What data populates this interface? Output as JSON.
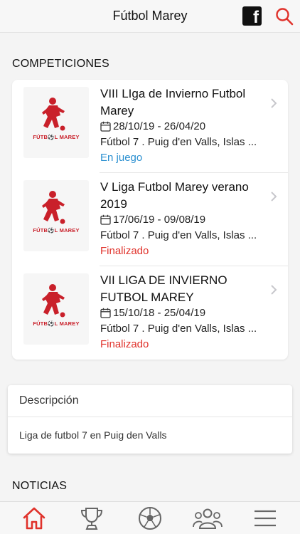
{
  "header": {
    "title": "Fútbol Marey",
    "facebook_icon": "facebook-icon",
    "search_icon": "search-icon",
    "accent_color": "#e0322b"
  },
  "competitions": {
    "section_title": "COMPETICIONES",
    "items": [
      {
        "name": "VIII LIga de Invierno Futbol Marey",
        "dates": "28/10/19 - 26/04/20",
        "place": "Fútbol 7 . Puig d'en Valls, Islas ...",
        "status": "En juego",
        "logo_text": "FÚTB⚽L MAREY"
      },
      {
        "name": "V Liga Futbol Marey verano 2019",
        "dates": "17/06/19 - 09/08/19",
        "place": "Fútbol 7 . Puig d'en Valls, Islas ...",
        "status": "Finalizado",
        "logo_text": "FÚTB⚽L MAREY"
      },
      {
        "name": "VII LIGA DE INVIERNO FUTBOL MAREY",
        "dates": "15/10/18 - 25/04/19",
        "place": "Fútbol 7 . Puig d'en Valls, Islas ...",
        "status": "Finalizado",
        "logo_text": "FÚTB⚽L MAREY"
      }
    ]
  },
  "description": {
    "title": "Descripción",
    "body": "Liga de futbol 7 en Puig den Valls"
  },
  "news": {
    "section_title": "NOTICIAS"
  },
  "tabbar": {
    "items": [
      "home-icon",
      "trophy-icon",
      "ball-icon",
      "group-icon",
      "menu-icon"
    ],
    "active": "home-icon"
  }
}
